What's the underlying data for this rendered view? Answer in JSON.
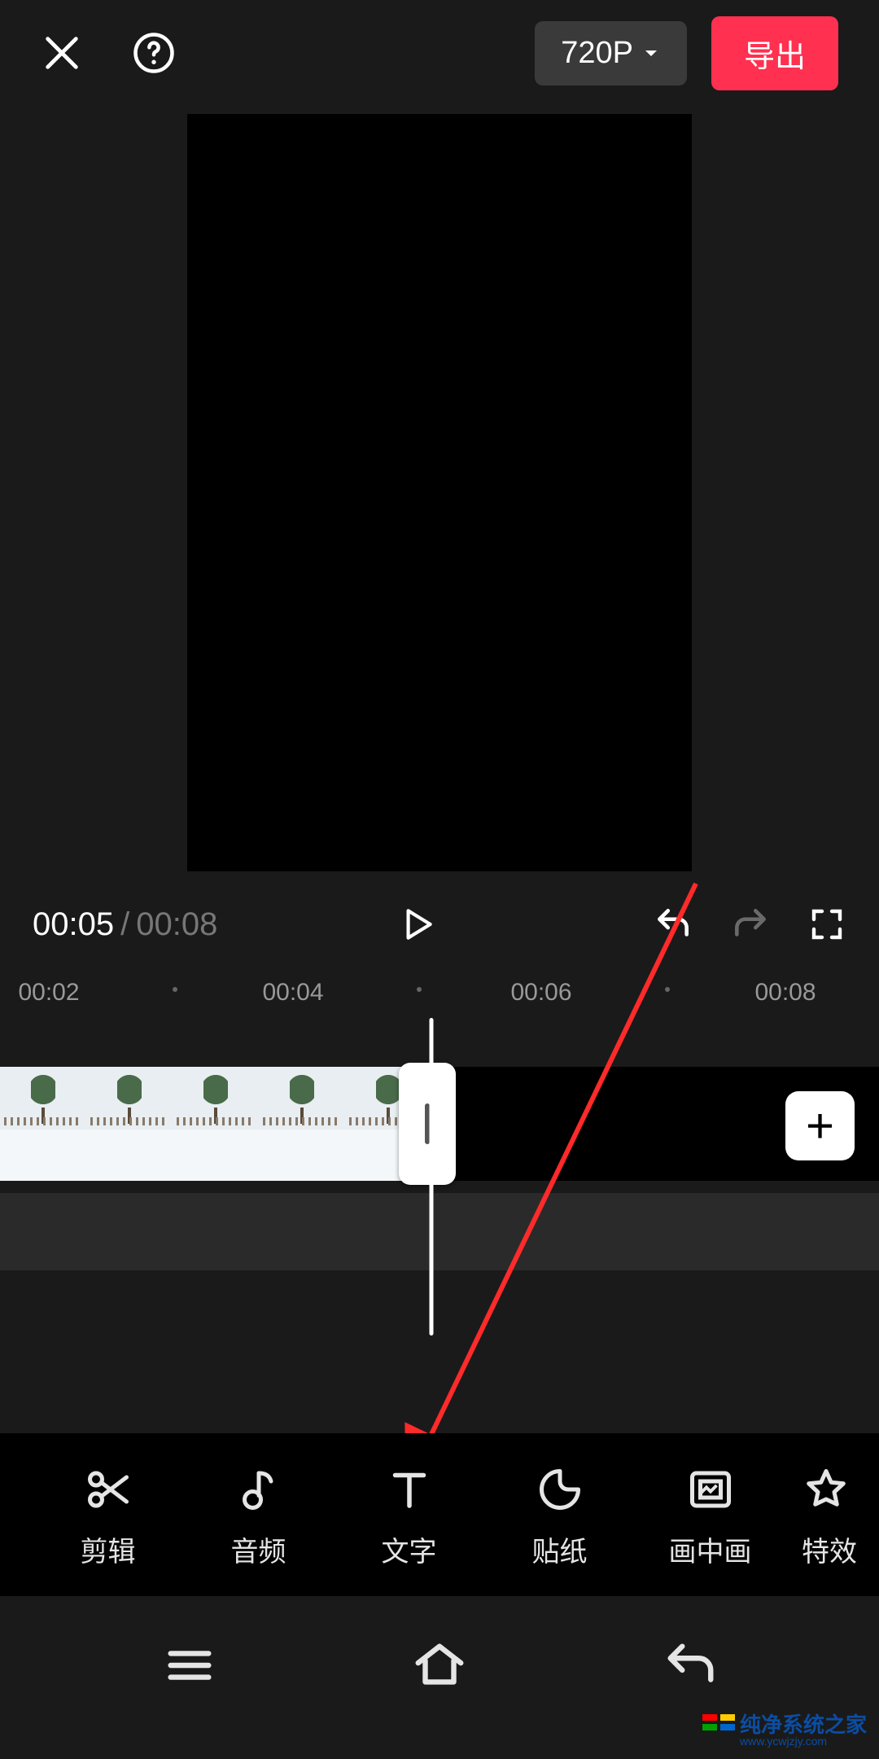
{
  "header": {
    "quality_label": "720P",
    "export_label": "导出"
  },
  "playback": {
    "current_time": "00:05",
    "separator": "/",
    "total_time": "00:08"
  },
  "ruler": {
    "marks": [
      "00:02",
      "00:04",
      "00:06",
      "00:08"
    ]
  },
  "tools": [
    {
      "id": "cut",
      "label": "剪辑"
    },
    {
      "id": "audio",
      "label": "音频"
    },
    {
      "id": "text",
      "label": "文字"
    },
    {
      "id": "sticker",
      "label": "贴纸"
    },
    {
      "id": "pip",
      "label": "画中画"
    },
    {
      "id": "effect",
      "label": "特效"
    }
  ],
  "add_button": {
    "glyph": "+"
  },
  "watermark": {
    "line1": "纯净系统之家",
    "line2": "www.ycwjzjy.com"
  }
}
